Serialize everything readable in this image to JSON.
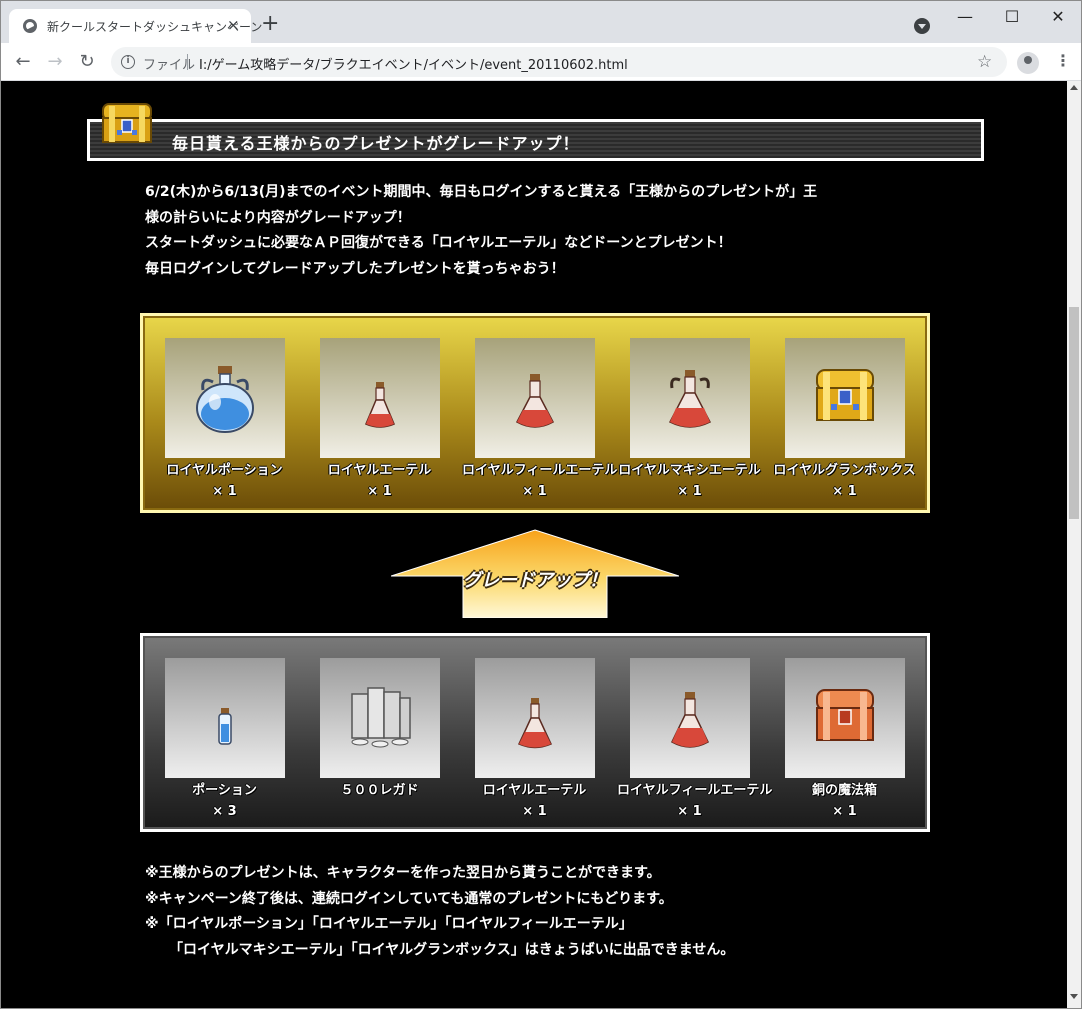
{
  "browser": {
    "tab_title": "新クールスタートダッシュキャンペーン",
    "tab_close": "×",
    "new_tab": "+",
    "scheme_label": "ファイル",
    "url": "I:/ゲーム攻略データ/ブラクエイベント/イベント/event_20110602.html",
    "window_minimize": "—",
    "window_maximize": "☐",
    "window_close": "✕",
    "back": "←",
    "forward": "→",
    "reload": "↻",
    "star": "☆",
    "menu": "⋮"
  },
  "header": {
    "title": "毎日貰える王様からのプレゼントがグレードアップ！"
  },
  "intro": {
    "line1": "6/2(木)から6/13(月)までのイベント期間中、毎日もログインすると貰える「王様からのプレゼントが」王",
    "line2": "様の計らいにより内容がグレードアップ！",
    "line3": "スタートダッシュに必要なＡＰ回復ができる「ロイヤルエーテル」などドーンとプレゼント！",
    "line4": "毎日ログインしてグレードアップしたプレゼントを貰っちゃおう！"
  },
  "upgraded_items": [
    {
      "name": "ロイヤルポーション",
      "qty": "× 1",
      "icon": "royal-potion-icon"
    },
    {
      "name": "ロイヤルエーテル",
      "qty": "× 1",
      "icon": "royal-ether-icon"
    },
    {
      "name": "ロイヤルフィールエーテル",
      "qty": "× 1",
      "icon": "royal-field-ether-icon"
    },
    {
      "name": "ロイヤルマキシエーテル",
      "qty": "× 1",
      "icon": "royal-maxi-ether-icon"
    },
    {
      "name": "ロイヤルグランボックス",
      "qty": "× 1",
      "icon": "gold-treasure-chest-icon"
    }
  ],
  "upgrade_label": "グレードアップ！",
  "original_items": [
    {
      "name": "ポーション",
      "qty": "× 3",
      "icon": "potion-icon"
    },
    {
      "name": "５００レガド",
      "qty": "",
      "icon": "coin-stacks-icon"
    },
    {
      "name": "ロイヤルエーテル",
      "qty": "× 1",
      "icon": "royal-ether-icon"
    },
    {
      "name": "ロイヤルフィールエーテル",
      "qty": "× 1",
      "icon": "royal-field-ether-icon"
    },
    {
      "name": "銅の魔法箱",
      "qty": "× 1",
      "icon": "copper-treasure-chest-icon"
    }
  ],
  "notes": {
    "line1": "※王様からのプレゼントは、キャラクターを作った翌日から貰うことができます。",
    "line2": "※キャンペーン終了後は、連続ログインしていても通常のプレゼントにもどります。",
    "line3": "※「ロイヤルポーション」「ロイヤルエーテル」「ロイヤルフィールエーテル」",
    "line4": "「ロイヤルマキシエーテル」「ロイヤルグランボックス」はきょうばいに出品できません。"
  },
  "colors": {
    "gold_panel": "#c9ad2c",
    "gray_panel": "#4a4a4a",
    "potion_red": "#d84a3a",
    "potion_blue": "#6fb6f0"
  }
}
